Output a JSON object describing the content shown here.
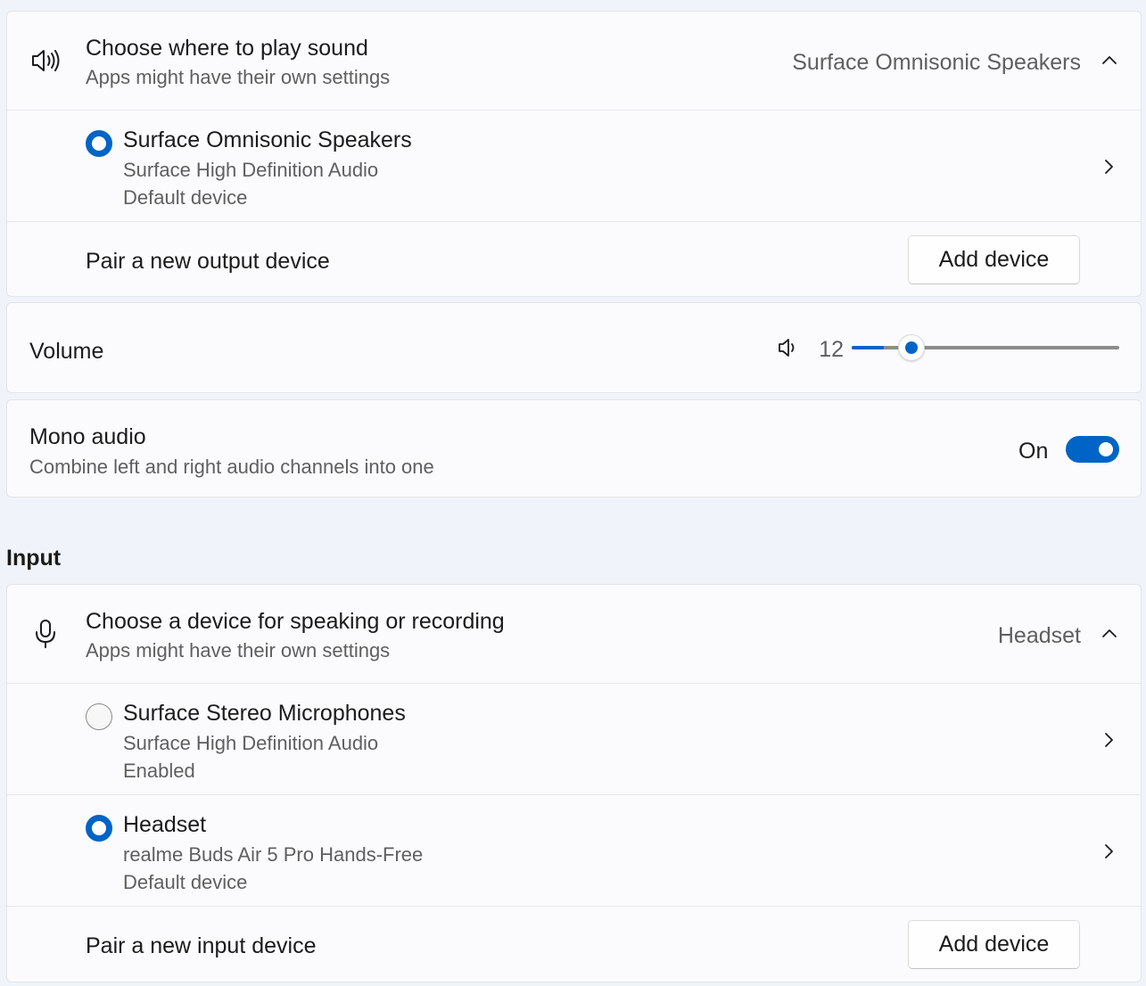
{
  "output": {
    "header": {
      "icon": "speaker-icon",
      "title": "Choose where to play sound",
      "subtitle": "Apps might have their own settings",
      "selected_value": "Surface Omnisonic Speakers",
      "expanded": true
    },
    "devices": [
      {
        "name": "Surface Omnisonic Speakers",
        "driver": "Surface High Definition Audio",
        "status": "Default device",
        "selected": true
      }
    ],
    "pair": {
      "label": "Pair a new output device",
      "button": "Add device"
    }
  },
  "volume": {
    "label": "Volume",
    "icon": "volume-icon",
    "value": "12",
    "level_percent": 12
  },
  "mono_audio": {
    "title": "Mono audio",
    "subtitle": "Combine left and right audio channels into one",
    "state_label": "On",
    "on": true
  },
  "input": {
    "section_title": "Input",
    "header": {
      "icon": "microphone-icon",
      "title": "Choose a device for speaking or recording",
      "subtitle": "Apps might have their own settings",
      "selected_value": "Headset",
      "expanded": true
    },
    "devices": [
      {
        "name": "Surface Stereo Microphones",
        "driver": "Surface High Definition Audio",
        "status": "Enabled",
        "selected": false
      },
      {
        "name": "Headset",
        "driver": "realme Buds Air 5 Pro Hands-Free",
        "status": "Default device",
        "selected": true
      }
    ],
    "pair": {
      "label": "Pair a new input device",
      "button": "Add device"
    }
  },
  "colors": {
    "accent": "#0064c6",
    "card": "#fbfbfd",
    "background": "#f0f3f9"
  }
}
